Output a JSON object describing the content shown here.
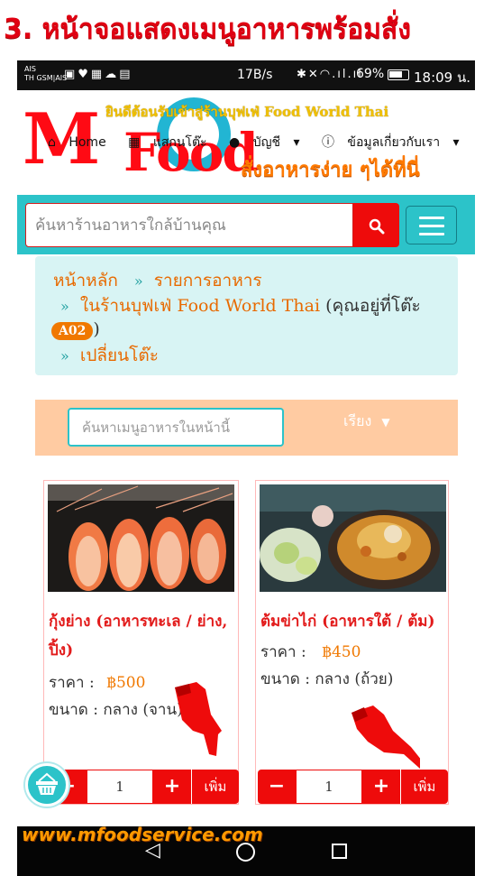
{
  "caption": "3. หน้าจอแสดงเมนูอาหารพร้อมสั่ง",
  "status_bar": {
    "carrier_line1": "AIS",
    "carrier_line2": "TH GSM|AIS",
    "speed": "17B/s",
    "battery": "69%",
    "time": "18:09 น."
  },
  "header": {
    "logo_m": "M",
    "logo_food": "Food",
    "welcome": "ยินดีต้อนรับเข้าสู่ร้านบุฟเฟ่ Food World Thai",
    "nav": {
      "home": "Home",
      "scan": "แสกนโต๊ะ",
      "account": "บัญชี",
      "about": "ข้อมูลเกี่ยวกับเรา"
    },
    "slogan": "สั่งอาหารง่าย ๆได้ที่นี่"
  },
  "search": {
    "placeholder": "ค้นหาร้านอาหารใกล้บ้านคุณ"
  },
  "breadcrumb": {
    "home": "หน้าหลัก",
    "food_list": "รายการอาหาร",
    "store_prefix": "ในร้านบุฟเฟ่ Food World Thai",
    "table_text": "(คุณอยู่ที่โต๊ะ",
    "table_no": "A02",
    "close_paren": ")",
    "change_table": "เปลี่ยนโต๊ะ"
  },
  "filter": {
    "menu_search_placeholder": "ค้นหาเมนูอาหารในหน้านี้",
    "sort_label": "เรียง"
  },
  "products": [
    {
      "name": "กุ้งย่าง (อาหารทะเล / ย่าง, ปิ้ง)",
      "price_label": "ราคา :",
      "price": "฿500",
      "size_label": "ขนาด :",
      "size": "กลาง (จาน)",
      "qty": "1",
      "add_label": "เพิ่ม"
    },
    {
      "name": "ต้มข่าไก่ (อาหารใต้ / ต้ม)",
      "price_label": "ราคา :",
      "price": "฿450",
      "size_label": "ขนาด :",
      "size": "กลาง (ถ้วย)",
      "qty": "1",
      "add_label": "เพิ่ม"
    }
  ],
  "footer_site": "www.mfoodservice.com",
  "colors": {
    "brand_red": "#ee0b0b",
    "teal": "#2cc3c9",
    "orange": "#f07800"
  }
}
